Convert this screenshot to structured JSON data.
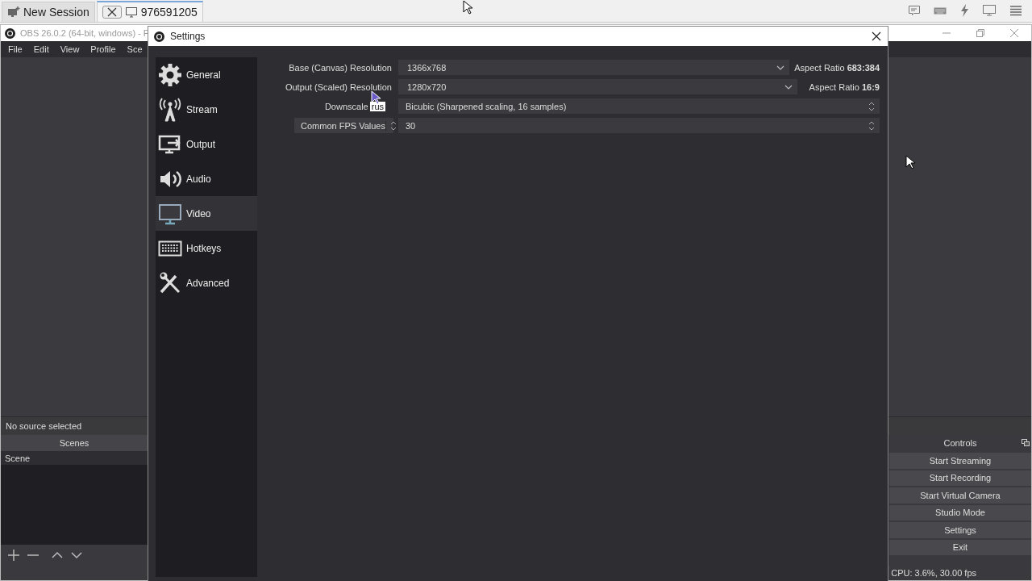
{
  "session_bar": {
    "tabs": [
      {
        "label": "New Session",
        "selected": false
      },
      {
        "label": "976591205",
        "selected": true
      }
    ]
  },
  "obs_window": {
    "title": "OBS 26.0.2 (64-bit, windows) - P",
    "menu": [
      "File",
      "Edit",
      "View",
      "Profile",
      "Sce"
    ],
    "source_status": "No source selected",
    "scenes": {
      "title": "Scenes",
      "items": [
        {
          "label": "Scene"
        }
      ]
    },
    "controls": {
      "title": "Controls",
      "buttons": [
        "Start Streaming",
        "Start Recording",
        "Start Virtual Camera",
        "Studio Mode",
        "Settings",
        "Exit"
      ]
    },
    "status": "CPU: 3.6%, 30.00 fps"
  },
  "settings": {
    "title": "Settings",
    "sections": [
      {
        "label": "General",
        "selected": false
      },
      {
        "label": "Stream",
        "selected": false
      },
      {
        "label": "Output",
        "selected": false
      },
      {
        "label": "Audio",
        "selected": false
      },
      {
        "label": "Video",
        "selected": true
      },
      {
        "label": "Hotkeys",
        "selected": false
      },
      {
        "label": "Advanced",
        "selected": false
      }
    ],
    "rows": [
      {
        "kind": "combo",
        "label_is_button": false,
        "label": "Base (Canvas) Resolution",
        "value": "1366x768",
        "aspect_label": "Aspect Ratio",
        "aspect_value": "683:384"
      },
      {
        "kind": "combo",
        "label_is_button": false,
        "label": "Output (Scaled) Resolution",
        "value": "1280x720",
        "aspect_label": "Aspect Ratio",
        "aspect_value": "16:9"
      },
      {
        "kind": "spin",
        "label_is_button": false,
        "label": "Downscale",
        "value": "Bicubic (Sharpened scaling, 16 samples)"
      },
      {
        "kind": "spin",
        "label_is_button": true,
        "label": "Common FPS Values",
        "value": "30"
      }
    ]
  },
  "ime_badge": "rus"
}
